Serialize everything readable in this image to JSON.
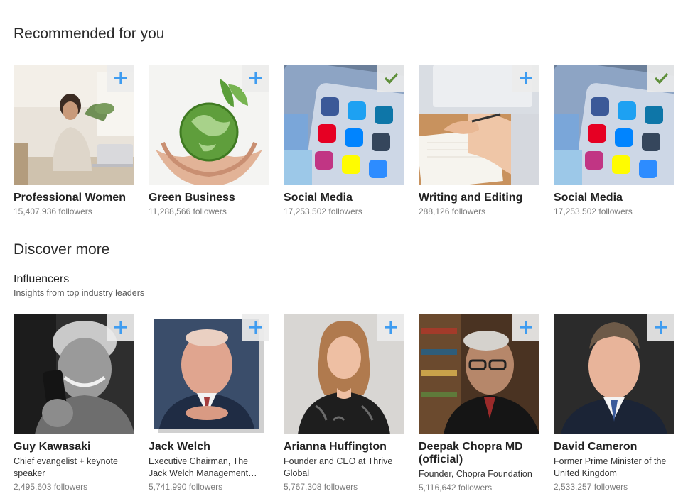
{
  "sections": {
    "recommended_title": "Recommended for you",
    "discover_title": "Discover more",
    "influencers_title": "Influencers",
    "influencers_subtitle": "Insights from top industry leaders"
  },
  "recommended": [
    {
      "name": "Professional Women",
      "followers": "15,407,936 followers",
      "followed": false,
      "image": "woman-laptop"
    },
    {
      "name": "Green Business",
      "followers": "11,288,566 followers",
      "followed": false,
      "image": "hands-globe"
    },
    {
      "name": "Social Media",
      "followers": "17,253,502 followers",
      "followed": true,
      "image": "social-apps-phone"
    },
    {
      "name": "Writing and Editing",
      "followers": "288,126 followers",
      "followed": false,
      "image": "hand-writing-notebook"
    },
    {
      "name": "Social Media",
      "followers": "17,253,502 followers",
      "followed": true,
      "image": "social-apps-phone"
    }
  ],
  "influencers": [
    {
      "name": "Guy Kawasaki",
      "desc": "Chief evangelist + keynote speaker",
      "followers": "2,495,603 followers",
      "followed": false,
      "image": "portrait-bw-phone"
    },
    {
      "name": "Jack Welch",
      "desc": "Executive Chairman, The Jack Welch Management…",
      "followers": "5,741,990 followers",
      "followed": false,
      "image": "portrait-suit"
    },
    {
      "name": "Arianna Huffington",
      "desc": "Founder and CEO at Thrive Global",
      "followers": "5,767,308 followers",
      "followed": false,
      "image": "portrait-woman"
    },
    {
      "name": "Deepak Chopra MD (official)",
      "desc": "Founder, Chopra Foundation",
      "followers": "5,116,642 followers",
      "followed": false,
      "image": "portrait-glasses"
    },
    {
      "name": "David Cameron",
      "desc": "Former Prime Minister of the United Kingdom",
      "followers": "2,533,257 followers",
      "followed": false,
      "image": "portrait-suit-tie"
    }
  ],
  "icons": {
    "follow": "plus-icon",
    "following": "checkmark-icon"
  },
  "colors": {
    "plus": "#3f9cf0",
    "check": "#5f8f3a",
    "name_text": "#222222",
    "followers_text": "#7a7a7a"
  }
}
